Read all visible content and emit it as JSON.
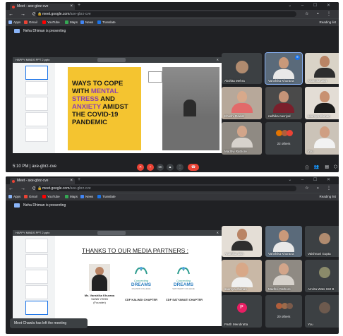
{
  "browser": {
    "tab_top": "Meet - axe-gbrz-cve",
    "tab_bottom": "Meet - axe-gbrz-cve",
    "url_domain": "meet.google.com",
    "url_path": "/axe-gbrz-cve",
    "bookmarks": [
      "Apps",
      "Gmail",
      "YouTube",
      "Maps",
      "News",
      "Translate"
    ],
    "reading_list": "Reading list"
  },
  "meet": {
    "presenting_label": "Neha Dhiman is presenting",
    "file_name": "HAPPY MINDS PPT 2.pptx",
    "meeting_code": "axe-gbrz-cve",
    "time_top": "5:10 PM"
  },
  "slide_top": {
    "heading": "WAYS TO COPE WITH MENTAL STRESS AND ANXIETY AMIDST THE COVID-19 PANDEMIC",
    "line1": "WAYS TO COPE",
    "line2_pre": "WITH ",
    "line2_em": "MENTAL",
    "line3_em": "STRESS",
    "line3_post": " AND",
    "line4_em": "ANXIETY",
    "line4_post": " AMIDST",
    "line5": "THE COVID-19",
    "line6": "PANDEMIC",
    "accent": "#f4c430",
    "highlight": "#8e44ad"
  },
  "slide_bottom": {
    "title": "THANKS TO OUR MEDIA PARTNERS :",
    "person_caption": "Ms. Vanshika Khurana",
    "person_caption2": "SANB YEEBI",
    "person_caption3": "(Founder)",
    "logo_text_a": "Connecting",
    "logo_text_b": "DREAMS",
    "logo1_sub": "KALINDI COLLEGE",
    "logo2_sub": "SATYAWATI COLLEGE",
    "chapter1": "CDF KALINDI CHAPTER",
    "chapter2": "CDF SATYAWATI CHAPTER"
  },
  "participants_top": [
    "Akshita Mehra",
    "Vanshika Khurana",
    "Anamika Jain",
    "Khushi Rawat",
    "radhika navriyal",
    "saumya dhiman",
    "Madhvi Rathore",
    "22 others",
    "You"
  ],
  "participants_bottom": [
    "Anamika Jain",
    "Vanshika Khurana",
    "Vaishnavi Gupta",
    "saumya dhiman",
    "Madhvi Rathore",
    "Amrita Wats 150 B",
    "Parth Mendiratta",
    "20 others",
    "You"
  ],
  "avatar_letter": "P",
  "toast": "Meet Chawla has left the meeting"
}
